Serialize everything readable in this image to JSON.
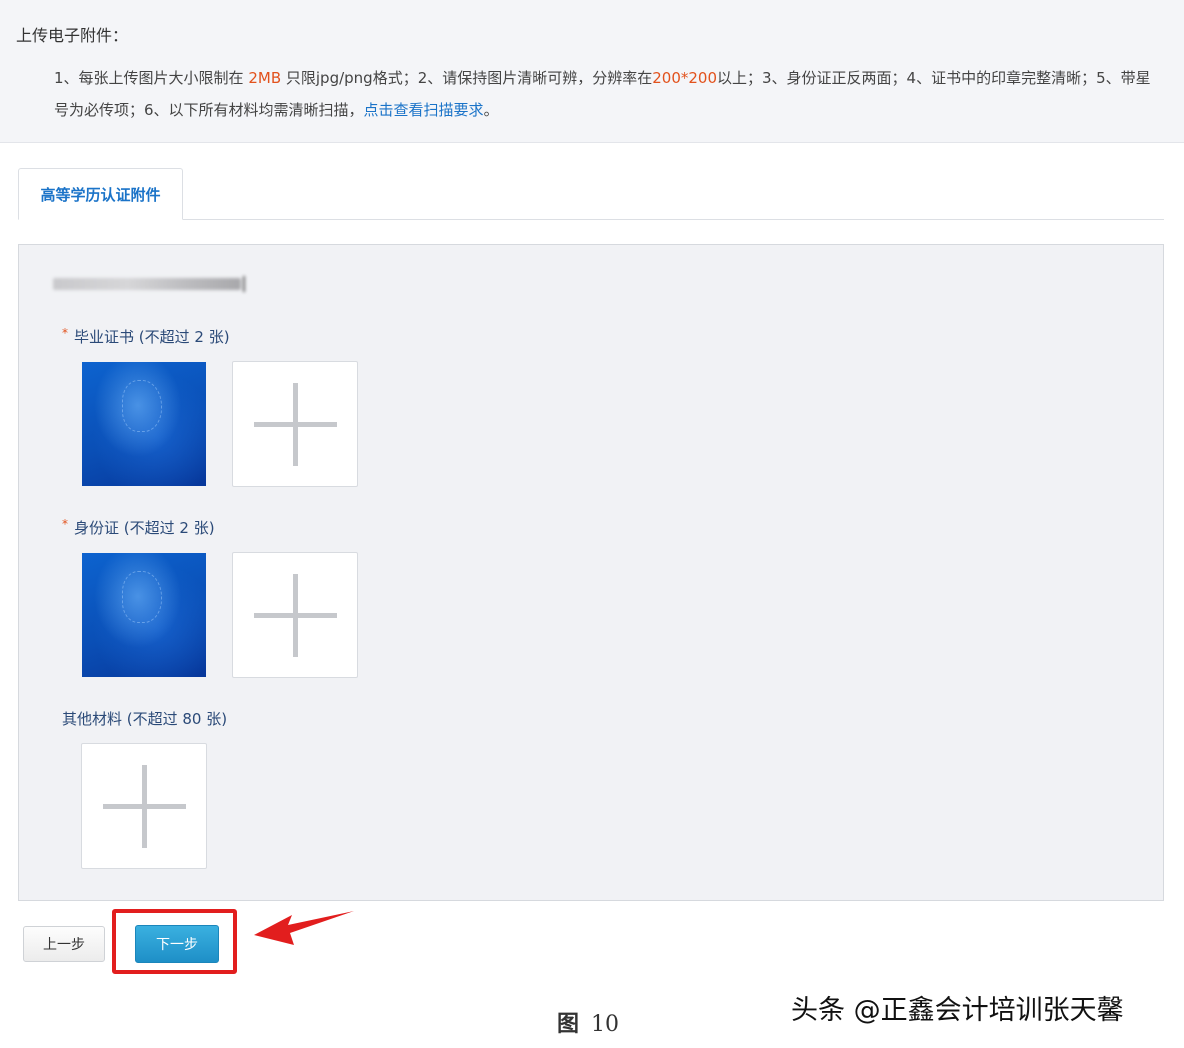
{
  "notice": {
    "title": "上传电子附件：",
    "item1_prefix": "1、每张上传图片大小限制在 ",
    "item1_size": "2MB",
    "item1_mid": " 只限jpg/png格式；2、请保持图片清晰可辨，分辨率在",
    "item1_res": "200*200",
    "item1_suffix": "以上；3、身份证正反两面；4、证书中的印章完整清晰；5、带星号为必传项；6、以下所有材料均需清晰扫描，",
    "link_text": "点击查看扫描要求",
    "end": "。"
  },
  "tabs": [
    {
      "label": "高等学历认证附件",
      "active": true
    }
  ],
  "sections": [
    {
      "label": "毕业证书 (不超过 2 张)",
      "required": true,
      "required_mark": "*"
    },
    {
      "label": "身份证 (不超过 2 张)",
      "required": true,
      "required_mark": "*"
    },
    {
      "label": "其他材料 (不超过 80 张)",
      "required": false
    }
  ],
  "buttons": {
    "prev_label": "上一步",
    "next_label": "下一步"
  },
  "caption": {
    "fig_label": "图",
    "fig_number": "10"
  },
  "watermark": "头条 @正鑫会计培训张天馨",
  "colors": {
    "accent_blue": "#1a73c8",
    "highlight_red": "#e21e1e",
    "next_button": "#1e8fc7",
    "required_red": "#e2521d"
  }
}
